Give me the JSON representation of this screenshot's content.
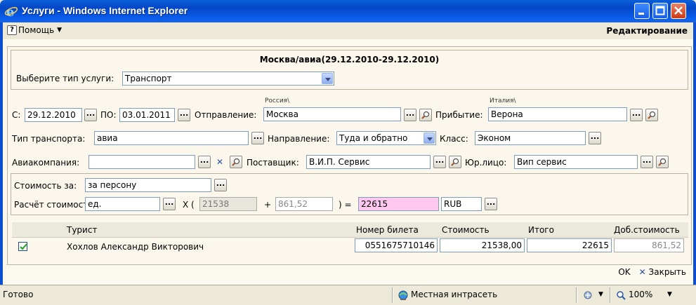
{
  "window": {
    "title": "Услуги - Windows Internet Explorer"
  },
  "menubar": {
    "help_label": "Помощь",
    "mode_label": "Редактирование"
  },
  "service": {
    "route_title": "Москва/авиа(29.12.2010-29.12.2010)",
    "type_label": "Выберите тип услуги:",
    "type_value": "Транспорт"
  },
  "trip": {
    "from_label": "С:",
    "from_date": "29.12.2010",
    "to_label": "ПО:",
    "to_date": "03.01.2011",
    "departure_label": "Отправление:",
    "departure_country": "Россия\\",
    "departure_city": "Москва",
    "arrival_label": "Прибытие:",
    "arrival_country": "Италия\\",
    "arrival_city": "Верона"
  },
  "transport": {
    "type_label": "Тип транспорта:",
    "type_value": "авиа",
    "direction_label": "Направление:",
    "direction_value": "Туда и обратно",
    "class_label": "Класс:",
    "class_value": "Эконом"
  },
  "partners": {
    "airline_label": "Авиакомпания:",
    "airline_value": "",
    "supplier_label": "Поставщик:",
    "supplier_value": "В.И.П. Сервис",
    "legal_label": "Юр.лицо:",
    "legal_value": "Вип сервис"
  },
  "cost": {
    "per_label": "Стоимость за:",
    "per_value": "за персону",
    "calc_label": "Расчёт стоимости:",
    "unit_value": "ед.",
    "x_open": "X (",
    "base_value": "21538",
    "plus": "+",
    "extra_value": "861,52",
    "close_eq": ") =",
    "total_value": "22615",
    "currency_value": "RUB"
  },
  "table": {
    "headers": {
      "tourist": "Турист",
      "ticket": "Номер билета",
      "price": "Стоимость",
      "total": "Итого",
      "extra": "Доб.стоимость"
    },
    "rows": [
      {
        "tourist": "Хохлов Александр Викторович",
        "ticket": "0551675710146",
        "price": "21538,00",
        "total": "22615",
        "extra": "861,52",
        "checked": true
      }
    ]
  },
  "actions": {
    "ok_label": "OK",
    "close_label": "Закрыть"
  },
  "statusbar": {
    "ready": "Готово",
    "zone": "Местная интрасеть",
    "zoom": "100%"
  },
  "colors": {
    "titlebar_blue": "#0a5fd8",
    "total_highlight": "#ffc8f0"
  }
}
